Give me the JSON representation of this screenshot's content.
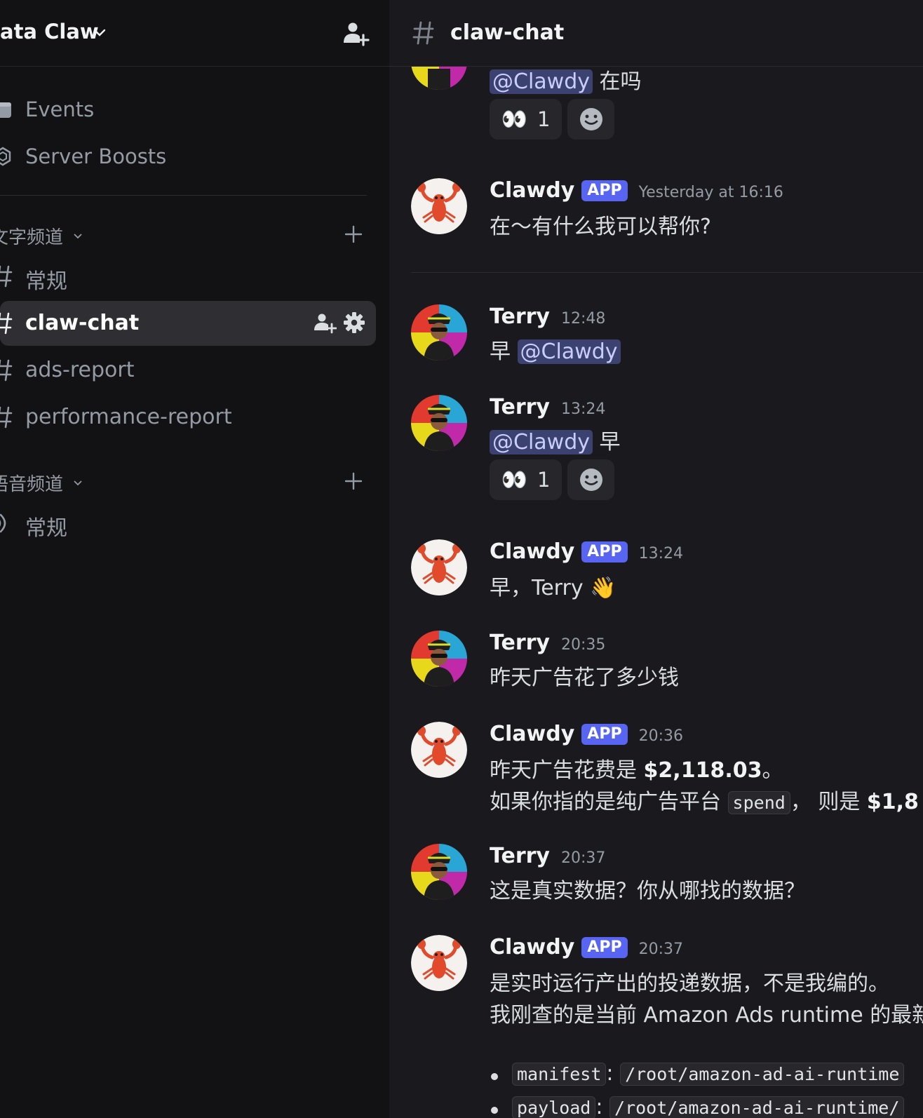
{
  "sidebar": {
    "server_name": "ata Claw",
    "items": [
      {
        "label": "Events",
        "icon": "calendar-icon"
      },
      {
        "label": "Server Boosts",
        "icon": "boost-icon"
      }
    ],
    "text_category": "文字频道",
    "voice_category": "语音频道",
    "text_channels": [
      {
        "label": "常规"
      },
      {
        "label": "claw-chat",
        "active": true
      },
      {
        "label": "ads-report"
      },
      {
        "label": "performance-report"
      }
    ],
    "voice_channels": [
      {
        "label": "常规"
      }
    ]
  },
  "chat": {
    "channel_title": "claw-chat",
    "messages": [
      {
        "text_mention": "@Clawdy",
        "text_rest": " 在吗",
        "reaction": {
          "emoji": "👀",
          "count": "1"
        }
      },
      {
        "author": "Clawdy",
        "badge": "APP",
        "time": "Yesterday at 16:16",
        "text": "在～有什么我可以帮你?"
      },
      {
        "author": "Terry",
        "time": "12:48",
        "text_prefix": "早 ",
        "text_mention": "@Clawdy"
      },
      {
        "author": "Terry",
        "time": "13:24",
        "text_mention": "@Clawdy",
        "text_rest": " 早",
        "reaction": {
          "emoji": "👀",
          "count": "1"
        }
      },
      {
        "author": "Clawdy",
        "badge": "APP",
        "time": "13:24",
        "text": "早，Terry 👋"
      },
      {
        "author": "Terry",
        "time": "20:35",
        "text": "昨天广告花了多少钱"
      },
      {
        "author": "Clawdy",
        "badge": "APP",
        "time": "20:36",
        "line1_prefix": "昨天广告花费是 ",
        "line1_bold": "$2,118.03",
        "line1_suffix": "。",
        "line2_prefix": "如果你指的是纯广告平台 ",
        "line2_code": "spend",
        "line2_mid": "，  则是 ",
        "line2_bold": "$1,8"
      },
      {
        "author": "Terry",
        "time": "20:37",
        "text": "这是真实数据？你从哪找的数据？"
      },
      {
        "author": "Clawdy",
        "badge": "APP",
        "time": "20:37",
        "line1": "是实时运行产出的投递数据，不是我编的。",
        "line2": "我刚查的是当前 Amazon Ads runtime 的最新",
        "bullets": [
          {
            "key": "manifest",
            "value": "/root/amazon-ad-ai-runtime"
          },
          {
            "key": "payload",
            "value": "/root/amazon-ad-ai-runtime/"
          }
        ]
      }
    ]
  },
  "colors": {
    "accent": "#5865f2",
    "mention_bg": "#3c4270",
    "sidebar_bg": "#121214",
    "chat_bg": "#1a1a1e"
  }
}
